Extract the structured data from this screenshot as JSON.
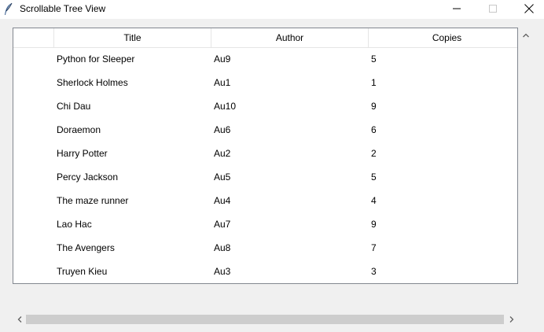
{
  "window": {
    "title": "Scrollable Tree View"
  },
  "tree": {
    "columns": [
      "Title",
      "Author",
      "Copies"
    ],
    "rows": [
      {
        "title": "Python for Sleeper",
        "author": "Au9",
        "copies": "5"
      },
      {
        "title": "Sherlock Holmes",
        "author": "Au1",
        "copies": "1"
      },
      {
        "title": "Chi Dau",
        "author": "Au10",
        "copies": "9"
      },
      {
        "title": "Doraemon",
        "author": "Au6",
        "copies": "6"
      },
      {
        "title": "Harry Potter",
        "author": "Au2",
        "copies": "2"
      },
      {
        "title": "Percy Jackson",
        "author": "Au5",
        "copies": "5"
      },
      {
        "title": "The maze runner",
        "author": "Au4",
        "copies": "4"
      },
      {
        "title": "Lao Hac",
        "author": "Au7",
        "copies": "9"
      },
      {
        "title": "The Avengers",
        "author": "Au8",
        "copies": "7"
      },
      {
        "title": "Truyen Kieu",
        "author": "Au3",
        "copies": "3"
      }
    ]
  },
  "icons": {
    "app": "feather-icon",
    "minimize": "minimize-icon",
    "maximize": "maximize-icon",
    "close": "close-icon",
    "scroll_up": "chevron-up-icon",
    "scroll_left": "chevron-left-icon",
    "scroll_right": "chevron-right-icon"
  },
  "colors": {
    "window_bg": "#f0f0f0",
    "tree_bg": "#ffffff",
    "border": "#828790",
    "scroll_thumb": "#cdcdcd"
  }
}
